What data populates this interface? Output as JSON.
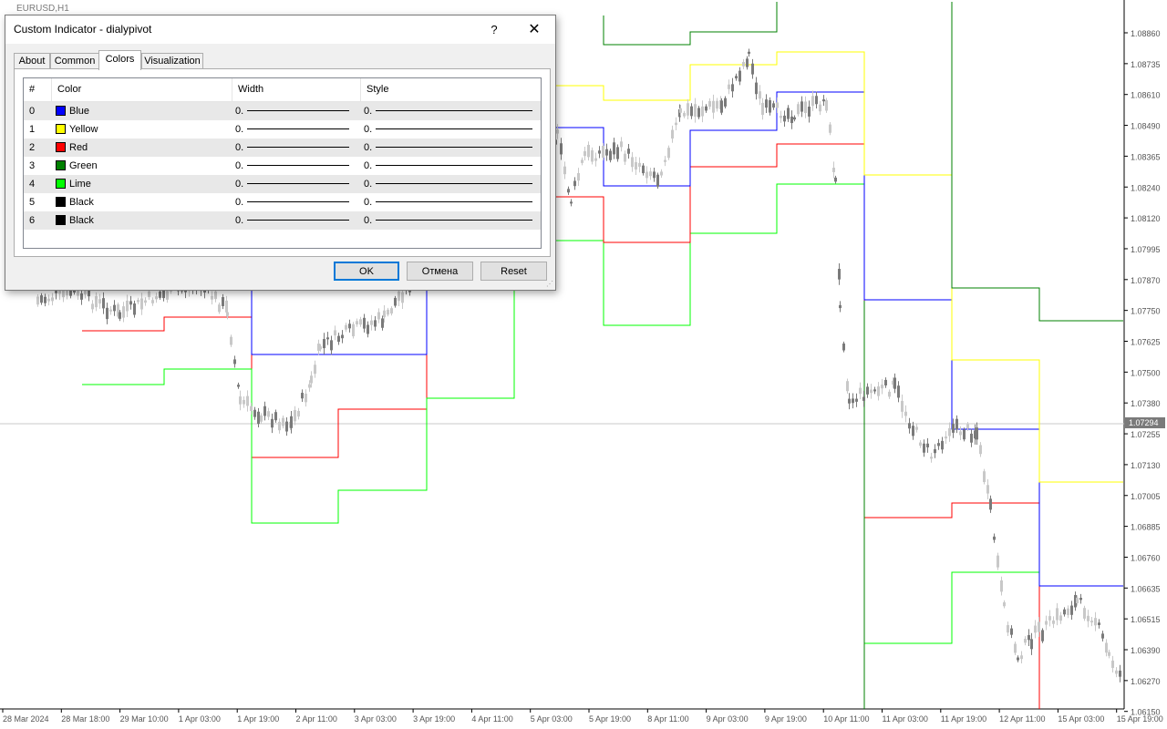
{
  "window": {
    "symbol": "EURUSD,H1"
  },
  "axis": {
    "price_labels": [
      "1.08860",
      "1.08735",
      "1.08610",
      "1.08490",
      "1.08365",
      "1.08240",
      "1.08120",
      "1.07995",
      "1.07870",
      "1.07750",
      "1.07625",
      "1.07500",
      "1.07380",
      "1.07255",
      "1.07130",
      "1.07005",
      "1.06885",
      "1.06760",
      "1.06635",
      "1.06515",
      "1.06390",
      "1.06270",
      "1.06150"
    ],
    "current_price": "1.07294",
    "time_labels": [
      "28 Mar 2024",
      "28 Mar 18:00",
      "29 Mar 10:00",
      "1 Apr 03:00",
      "1 Apr 19:00",
      "2 Apr 11:00",
      "3 Apr 03:00",
      "3 Apr 19:00",
      "4 Apr 11:00",
      "5 Apr 03:00",
      "5 Apr 19:00",
      "8 Apr 11:00",
      "9 Apr 03:00",
      "9 Apr 19:00",
      "10 Apr 11:00",
      "11 Apr 03:00",
      "11 Apr 19:00",
      "12 Apr 11:00",
      "15 Apr 03:00",
      "15 Apr 19:00"
    ]
  },
  "colors": {
    "blue": "#0000ff",
    "yellow": "#ffff00",
    "red": "#ff0000",
    "green": "#008000",
    "lime": "#00ff00",
    "black": "#000000",
    "candle": "#7a7a7a",
    "grid_text": "#555555"
  },
  "dialog": {
    "title": "Custom Indicator - dialypivot",
    "help": "?",
    "close": "✕",
    "tabs": [
      {
        "label": "About"
      },
      {
        "label": "Common"
      },
      {
        "label": "Colors"
      },
      {
        "label": "Visualization"
      }
    ],
    "active_tab": "Colors",
    "columns": {
      "index": "#",
      "color": "Color",
      "width": "Width",
      "style": "Style"
    },
    "rows": [
      {
        "index": "0",
        "color_name": "Blue",
        "color": "#0000ff",
        "width": "0.",
        "style": "0."
      },
      {
        "index": "1",
        "color_name": "Yellow",
        "color": "#ffff00",
        "width": "0.",
        "style": "0."
      },
      {
        "index": "2",
        "color_name": "Red",
        "color": "#ff0000",
        "width": "0.",
        "style": "0."
      },
      {
        "index": "3",
        "color_name": "Green",
        "color": "#008000",
        "width": "0.",
        "style": "0."
      },
      {
        "index": "4",
        "color_name": "Lime",
        "color": "#00ff00",
        "width": "0.",
        "style": "0."
      },
      {
        "index": "5",
        "color_name": "Black",
        "color": "#000000",
        "width": "0.",
        "style": "0."
      },
      {
        "index": "6",
        "color_name": "Black",
        "color": "#000000",
        "width": "0.",
        "style": "0."
      }
    ],
    "buttons": {
      "ok": "OK",
      "cancel": "Отмена",
      "reset": "Reset"
    }
  }
}
